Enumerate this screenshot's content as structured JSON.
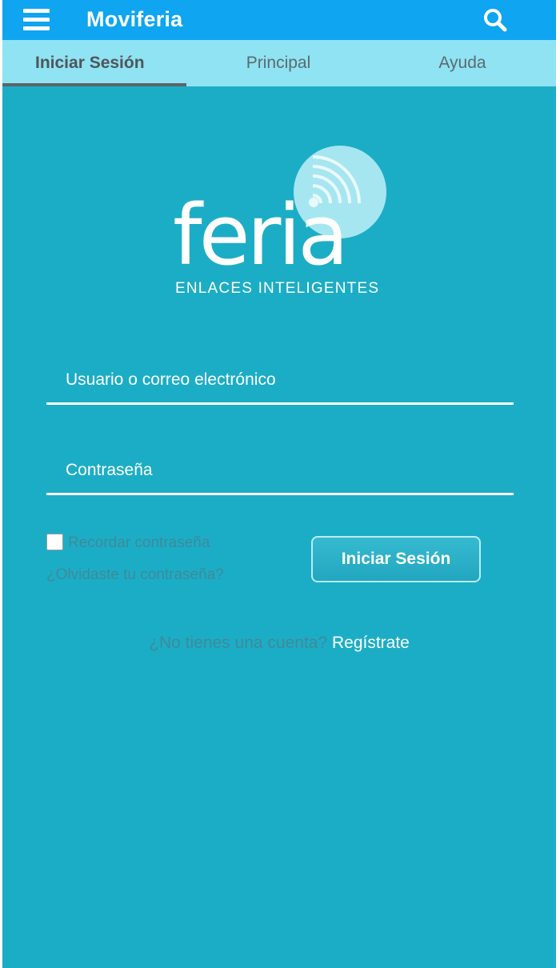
{
  "app": {
    "title": "Moviferia",
    "colors": {
      "appbar": "#0fa5f0",
      "tabbar": "#8fe3f3",
      "background": "#1cadc6"
    }
  },
  "tabs": [
    {
      "label": "Iniciar Sesión",
      "active": true
    },
    {
      "label": "Principal",
      "active": false
    },
    {
      "label": "Ayuda",
      "active": false
    }
  ],
  "logo": {
    "wordmark": "feria",
    "tagline": "ENLACES INTELIGENTES"
  },
  "login": {
    "user_placeholder": "Usuario o correo electrónico",
    "password_placeholder": "Contraseña",
    "remember_label": "Recordar contraseña",
    "remember_checked": false,
    "forgot_label": "¿Olvidaste tu contraseña?",
    "submit_label": "Iniciar Sesión"
  },
  "signup": {
    "question": "¿No tienes una cuenta?",
    "link_label": "Regístrate"
  },
  "icons": {
    "menu": "hamburger-menu-icon",
    "search": "search-icon"
  }
}
